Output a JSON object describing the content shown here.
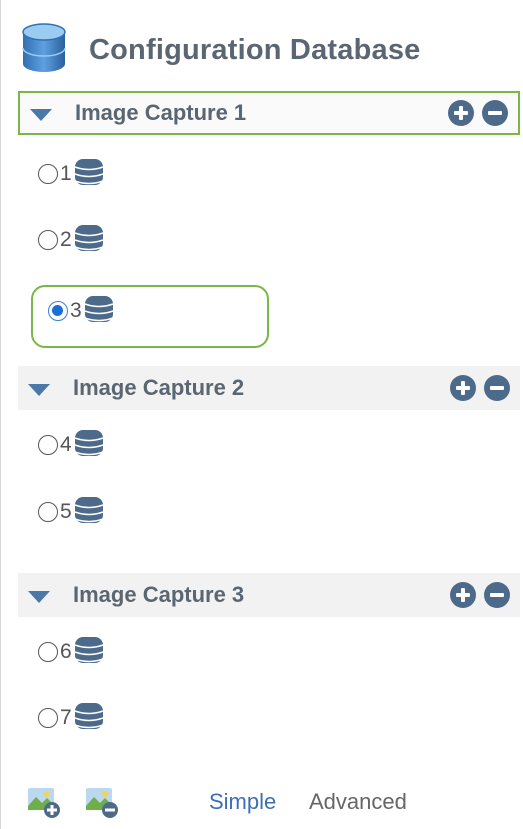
{
  "header": {
    "title": "Configuration Database",
    "icon": "database-icon"
  },
  "groups": [
    {
      "label": "Image Capture 1",
      "items": [
        {
          "number": "1",
          "checked": false
        },
        {
          "number": "2",
          "checked": false
        },
        {
          "number": "3",
          "checked": true
        }
      ]
    },
    {
      "label": "Image Capture 2",
      "items": [
        {
          "number": "4",
          "checked": false
        },
        {
          "number": "5",
          "checked": false
        }
      ]
    },
    {
      "label": "Image Capture 3",
      "items": [
        {
          "number": "6",
          "checked": false
        },
        {
          "number": "7",
          "checked": false
        }
      ]
    }
  ],
  "footer": {
    "simple_label": "Simple",
    "advanced_label": "Advanced"
  },
  "colors": {
    "accent_green": "#7ab648",
    "icon_navy": "#4d6a8a",
    "link_blue": "#3e6fb5",
    "arrow_blue": "#4a78a8"
  }
}
